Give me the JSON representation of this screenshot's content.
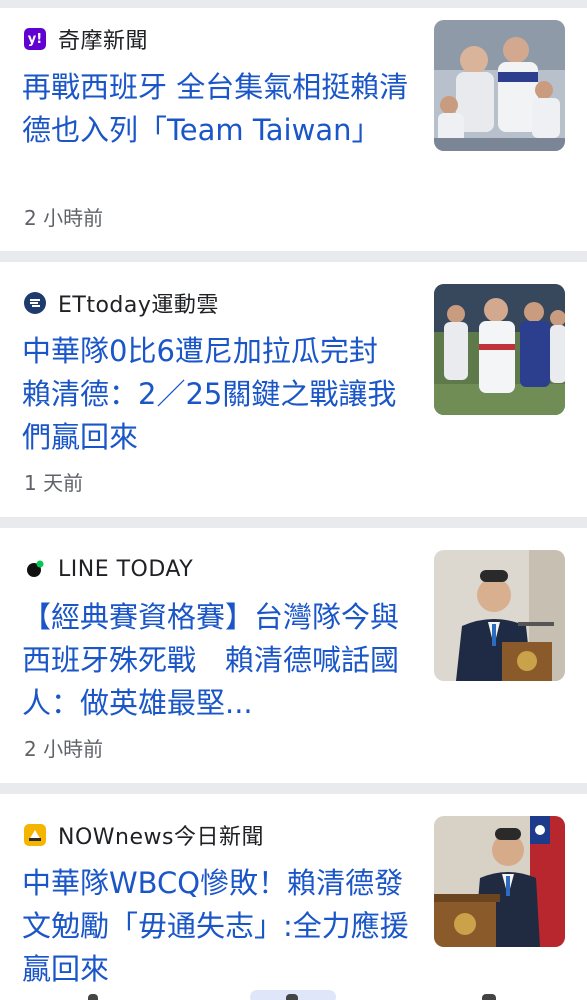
{
  "articles": [
    {
      "source": "奇摩新聞",
      "logo_icon": "yahoo-logo-icon",
      "logo_text": "y!",
      "logo_color": "#6001d2",
      "title": "再戰西班牙 全台集氣相挺賴清德也入列「Team Taiwan」",
      "time": "2 小時前",
      "thumbnail": "baseball-team-photo"
    },
    {
      "source": "ETtoday運動雲",
      "logo_icon": "ettoday-logo-icon",
      "logo_text": "",
      "logo_color": "#1f3b6e",
      "title": "中華隊0比6遭尼加拉瓜完封　賴清德：2／25關鍵之戰讓我們贏回來",
      "time": "1 天前",
      "thumbnail": "baseball-players-walking-photo"
    },
    {
      "source": "LINE TODAY",
      "logo_icon": "line-today-logo-icon",
      "logo_text": "",
      "logo_color": "#111111",
      "title": "【經典賽資格賽】台灣隊今與西班牙殊死戰　賴清德喊話國人：做英雄最堅...",
      "time": "2 小時前",
      "thumbnail": "president-podium-photo"
    },
    {
      "source": "NOWnews今日新聞",
      "logo_icon": "nownews-logo-icon",
      "logo_text": "",
      "logo_color": "#f5b400",
      "title": "中華隊WBCQ慘敗！賴清德發文勉勵「毋通失志」:全力應援贏回來",
      "time": "",
      "thumbnail": "president-speech-flag-photo"
    }
  ],
  "colors": {
    "title_blue": "#1a56c8",
    "separator": "#e9eaee"
  }
}
